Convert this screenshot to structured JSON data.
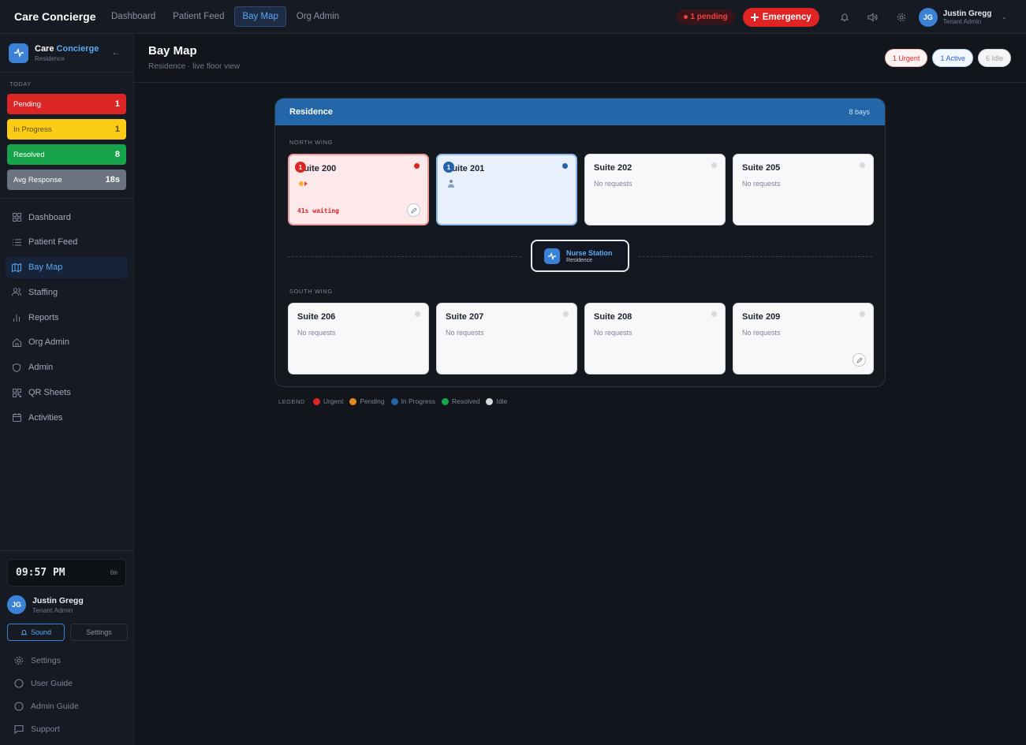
{
  "topbar": {
    "brand": "Care Concierge",
    "nav": [
      "Dashboard",
      "Patient Feed",
      "Bay Map",
      "Org Admin"
    ],
    "active_nav": "Bay Map",
    "pending_label": "1 pending",
    "emergency_label": "Emergency",
    "icons": [
      "bell-icon",
      "speaker-icon",
      "gear-icon"
    ],
    "user": {
      "initials": "JG",
      "name": "Justin Gregg",
      "role": "Tenant Admin"
    }
  },
  "sidebar": {
    "brand_plain": "Care",
    "brand_accent": "Concierge",
    "subtitle": "Residence",
    "today_label": "TODAY",
    "stats": [
      {
        "label": "Pending",
        "value": "1",
        "color": "#dc2626"
      },
      {
        "label": "In Progress",
        "value": "1",
        "color": "#facc15"
      },
      {
        "label": "Resolved",
        "value": "8",
        "color": "#16a34a"
      },
      {
        "label": "Avg Response",
        "value": "18s",
        "color": "#6b7280"
      }
    ],
    "menu": [
      {
        "label": "Dashboard",
        "icon": "grid-icon"
      },
      {
        "label": "Patient Feed",
        "icon": "list-icon"
      },
      {
        "label": "Bay Map",
        "icon": "map-icon",
        "active": true
      },
      {
        "label": "Staffing",
        "icon": "users-icon"
      },
      {
        "label": "Reports",
        "icon": "bar-chart-icon"
      },
      {
        "label": "Org Admin",
        "icon": "home-icon"
      },
      {
        "label": "Admin",
        "icon": "shield-icon"
      },
      {
        "label": "QR Sheets",
        "icon": "qr-icon"
      },
      {
        "label": "Activities",
        "icon": "calendar-icon"
      }
    ],
    "clock": {
      "time": "09:57 PM",
      "elapsed": "0m"
    },
    "user": {
      "initials": "JG",
      "name": "Justin Gregg",
      "role": "Tenant Admin"
    },
    "sound_label": "Sound",
    "settings_btn_label": "Settings",
    "footer_links": [
      {
        "label": "Settings",
        "icon": "gear-icon"
      },
      {
        "label": "User Guide",
        "icon": "circle-icon"
      },
      {
        "label": "Admin Guide",
        "icon": "circle-icon"
      },
      {
        "label": "Support",
        "icon": "chat-icon"
      }
    ]
  },
  "main": {
    "title": "Bay Map",
    "subtitle": "Residence · live floor view",
    "pills": {
      "urgent": "1 Urgent",
      "active": "1 Active",
      "idle": "6 Idle"
    },
    "map": {
      "title": "Residence",
      "count": "8 bays",
      "north_label": "NORTH WING",
      "south_label": "SOUTH WING",
      "north": [
        {
          "name": "Suite 200",
          "status": "urgent",
          "badge": "1",
          "waiting": "41s waiting"
        },
        {
          "name": "Suite 201",
          "status": "inprogress",
          "badge": "1"
        },
        {
          "name": "Suite 202",
          "status": "idle",
          "requests": "No requests"
        },
        {
          "name": "Suite 205",
          "status": "idle",
          "requests": "No requests"
        }
      ],
      "south": [
        {
          "name": "Suite 206",
          "status": "idle",
          "requests": "No requests"
        },
        {
          "name": "Suite 207",
          "status": "idle",
          "requests": "No requests"
        },
        {
          "name": "Suite 208",
          "status": "idle",
          "requests": "No requests"
        },
        {
          "name": "Suite 209",
          "status": "idle",
          "requests": "No requests"
        }
      ],
      "nurse_station": {
        "title": "Nurse Station",
        "subtitle": "Residence"
      }
    },
    "legend": {
      "title": "LEGEND",
      "items": [
        {
          "label": "Urgent",
          "color": "#dc2626"
        },
        {
          "label": "Pending",
          "color": "#e08a1e"
        },
        {
          "label": "In Progress",
          "color": "#2563a8"
        },
        {
          "label": "Resolved",
          "color": "#16a34a"
        },
        {
          "label": "Idle",
          "color": "#d6d9de"
        }
      ]
    }
  }
}
